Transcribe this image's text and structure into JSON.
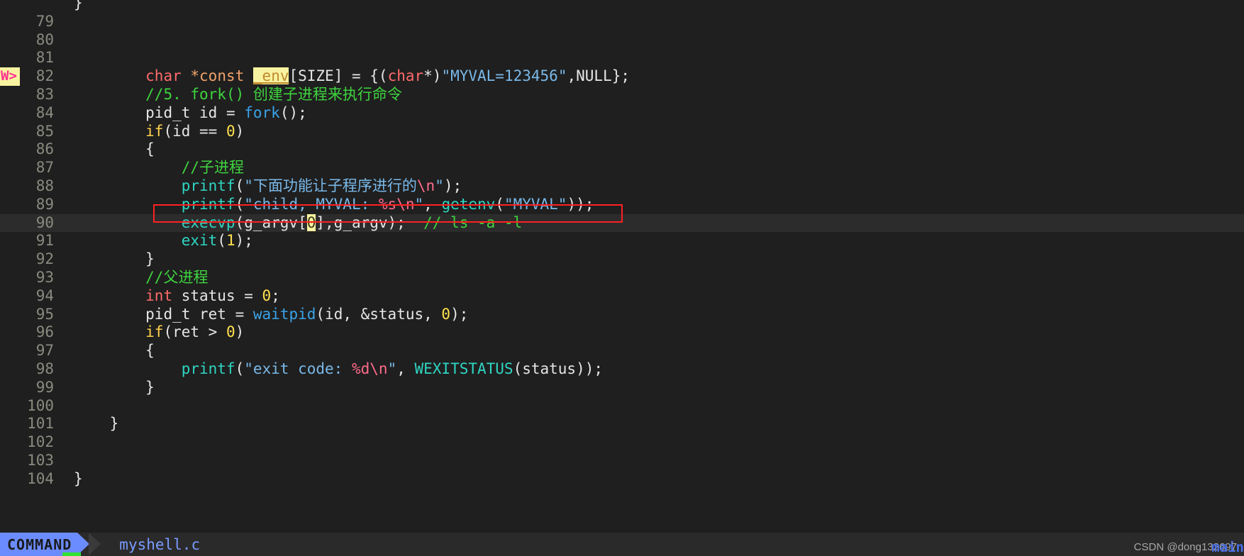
{
  "editor": {
    "filename": "myshell.c",
    "mode": "COMMAND",
    "sign_marker": "W>",
    "first_partial_line": "}",
    "accent_mode_bg": "#6b8cff",
    "accent_filename": "#7a9cff",
    "annotation_box_color": "#ff2020",
    "current_line_number": 90,
    "search_highlight": "_env"
  },
  "lines": [
    {
      "n": "79",
      "text": ""
    },
    {
      "n": "80",
      "text": ""
    },
    {
      "n": "81",
      "text": ""
    },
    {
      "n": "82",
      "text": "        char *const _env[SIZE] = {(char*)\"MYVAL=123456\",NULL};"
    },
    {
      "n": "83",
      "text": "        //5. fork() 创建子进程来执行命令"
    },
    {
      "n": "84",
      "text": "        pid_t id = fork();"
    },
    {
      "n": "85",
      "text": "        if(id == 0)"
    },
    {
      "n": "86",
      "text": "        {"
    },
    {
      "n": "87",
      "text": "            //子进程"
    },
    {
      "n": "88",
      "text": "            printf(\"下面功能让子程序进行的\\n\");"
    },
    {
      "n": "89",
      "text": "            printf(\"child, MYVAL: %s\\n\", getenv(\"MYVAL\"));"
    },
    {
      "n": "90",
      "text": "            execvp(g_argv[0],g_argv);  // ls -a -l"
    },
    {
      "n": "91",
      "text": "            exit(1);"
    },
    {
      "n": "92",
      "text": "        }"
    },
    {
      "n": "93",
      "text": "        //父进程"
    },
    {
      "n": "94",
      "text": "        int status = 0;"
    },
    {
      "n": "95",
      "text": "        pid_t ret = waitpid(id, &status, 0);"
    },
    {
      "n": "96",
      "text": "        if(ret > 0)"
    },
    {
      "n": "97",
      "text": "        {"
    },
    {
      "n": "98",
      "text": "            printf(\"exit code: %d\\n\", WEXITSTATUS(status));"
    },
    {
      "n": "99",
      "text": "        }"
    },
    {
      "n": "100",
      "text": ""
    },
    {
      "n": "101",
      "text": "    }"
    },
    {
      "n": "102",
      "text": ""
    },
    {
      "n": "103",
      "text": ""
    },
    {
      "n": "104",
      "text": "}"
    }
  ],
  "line_numbers": {
    "l78": "",
    "l79": "79",
    "l80": "80",
    "l81": "81",
    "l82": "82",
    "l83": "83",
    "l84": "84",
    "l85": "85",
    "l86": "86",
    "l87": "87",
    "l88": "88",
    "l89": "89",
    "l90": "90",
    "l91": "91",
    "l92": "92",
    "l93": "93",
    "l94": "94",
    "l95": "95",
    "l96": "96",
    "l97": "97",
    "l98": "98",
    "l99": "99",
    "l100": "100",
    "l101": "101",
    "l102": "102",
    "l103": "103",
    "l104": "104"
  },
  "tokens": {
    "t82_char": "char",
    "t82_sp1": " ",
    "t82_star_const": "*const",
    "t82_sp2": " ",
    "t82_env": "_env",
    "t82_size": "[SIZE]",
    "t82_eq": " = ",
    "t82_open": "{(",
    "t82_char2": "char",
    "t82_starclose": "*)",
    "t82_str": "\"MYVAL=123456\"",
    "t82_comma": ",",
    "t82_null": "NULL",
    "t82_end": "};",
    "t83_comment": "//5. fork() 创建子进程来执行命令",
    "t84_pidt": "pid_t",
    "t84_id": " id = ",
    "t84_fork": "fork",
    "t84_end": "();",
    "t85_if": "if",
    "t85_open": "(id == ",
    "t85_zero": "0",
    "t85_close": ")",
    "t86_brace": "{",
    "t87_comment": "//子进程",
    "t88_printf": "printf",
    "t88_p1": "(",
    "t88_str": "\"下面功能让子程序进行的",
    "t88_esc": "\\n",
    "t88_str2": "\"",
    "t88_end": ");",
    "t89_printf": "printf",
    "t89_p1": "(",
    "t89_str": "\"child, MYVAL: ",
    "t89_pct": "%s",
    "t89_esc": "\\n",
    "t89_str2": "\"",
    "t89_comma": ", ",
    "t89_getenv": "getenv",
    "t89_p2": "(",
    "t89_str3": "\"MYVAL\"",
    "t89_end": "));",
    "t90_execvp": "execvp",
    "t90_open": "(g_argv[",
    "t90_zero": "0",
    "t90_mid": "],g_argv);",
    "t90_sp": "  ",
    "t90_comment": "// ls -a -l",
    "t91_exit": "exit",
    "t91_open": "(",
    "t91_one": "1",
    "t91_close": ");",
    "t92_brace": "}",
    "t93_comment": "//父进程",
    "t94_int": "int",
    "t94_status": " status = ",
    "t94_zero": "0",
    "t94_semi": ";",
    "t95_pidt": "pid_t",
    "t95_ret": " ret = ",
    "t95_waitpid": "waitpid",
    "t95_open": "(id, &status, ",
    "t95_zero": "0",
    "t95_close": ");",
    "t96_if": "if",
    "t96_open": "(ret > ",
    "t96_zero": "0",
    "t96_close": ")",
    "t97_brace": "{",
    "t98_printf": "printf",
    "t98_p1": "(",
    "t98_str": "\"exit code: ",
    "t98_pct": "%d",
    "t98_esc": "\\n",
    "t98_str2": "\"",
    "t98_comma": ", ",
    "t98_wexit": "WEXITSTATUS",
    "t98_open": "(status",
    "t98_end": "));",
    "t99_brace": "}",
    "t101_brace": "}",
    "t104_brace": "}",
    "t78_brace": "}"
  },
  "watermark": {
    "text": "CSDN @dong132697",
    "overlay": "main"
  }
}
